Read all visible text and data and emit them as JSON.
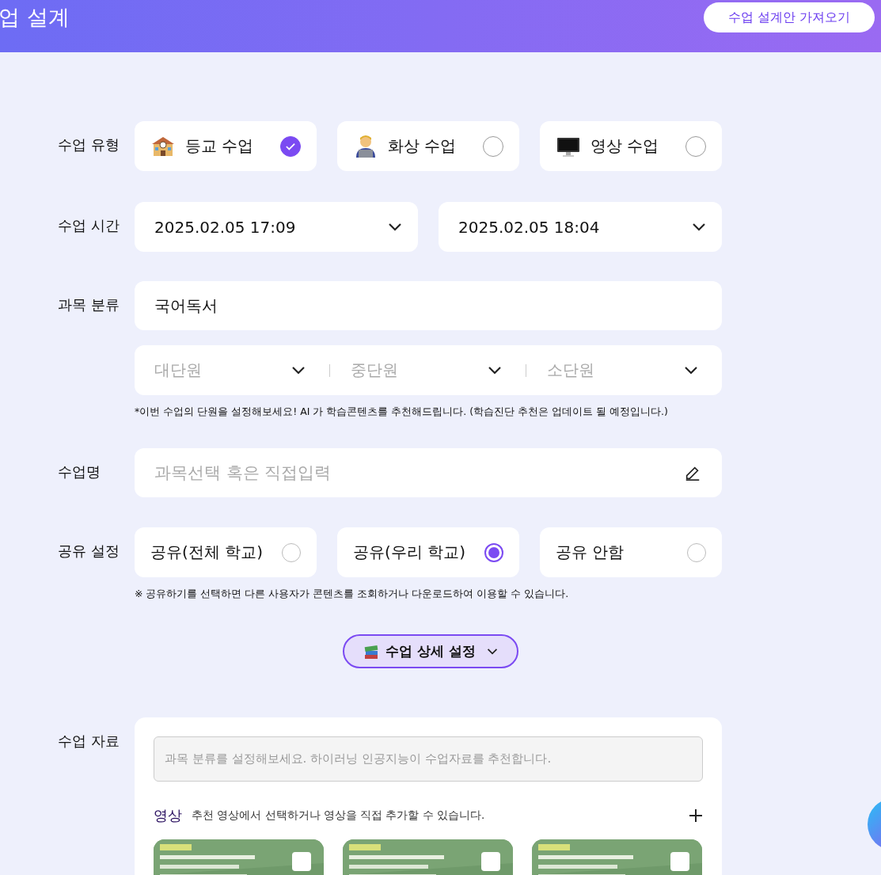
{
  "header": {
    "title": "업 설계",
    "import_button": "수업 설계안 가져오기"
  },
  "class_type": {
    "label": "수업 유형",
    "options": [
      {
        "kind": "school",
        "text": "등교 수업",
        "selected": true
      },
      {
        "kind": "video_call",
        "text": "화상 수업",
        "selected": false
      },
      {
        "kind": "monitor",
        "text": "영상 수업",
        "selected": false
      }
    ]
  },
  "class_time": {
    "label": "수업 시간",
    "start": "2025.02.05 17:09",
    "end": "2025.02.05 18:04"
  },
  "subject": {
    "label": "과목 분류",
    "value": "국어독서",
    "units": [
      {
        "placeholder": "대단원"
      },
      {
        "placeholder": "중단원"
      },
      {
        "placeholder": "소단원"
      }
    ],
    "note": "*이번 수업의 단원을 설정해보세요! AI 가 학습콘텐츠를 추천해드립니다. (학습진단 추천은 업데이트 될 예정입니다.)"
  },
  "class_name": {
    "label": "수업명",
    "placeholder": "과목선택 혹은 직접입력"
  },
  "sharing": {
    "label": "공유 설정",
    "options": [
      {
        "text": "공유(전체 학교)",
        "selected": false
      },
      {
        "text": "공유(우리 학교)",
        "selected": true
      },
      {
        "text": "공유 안함",
        "selected": false
      }
    ],
    "note": "※ 공유하기를 선택하면 다른 사용자가 콘텐츠를 조회하거나 다운로드하여 이용할 수 있습니다."
  },
  "detail_button": "수업 상세 설정",
  "materials": {
    "label": "수업 자료",
    "placeholder": "과목 분류를 설정해보세요. 하이러닝 인공지능이 수업자료를 추천합니다.",
    "video_title": "영상",
    "video_desc": "추천 영상에서 선택하거나 영상을 직접 추가할 수 있습니다."
  }
}
